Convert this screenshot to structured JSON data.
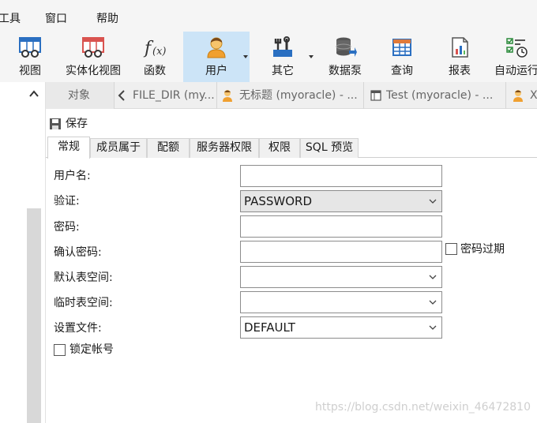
{
  "menu": {
    "tools": "工具",
    "window": "窗口",
    "help": "帮助"
  },
  "toolbar": {
    "view": "视图",
    "materialized_view": "实体化视图",
    "function": "函数",
    "user": "用户",
    "other": "其它",
    "data_pump": "数据泵",
    "query": "查询",
    "report": "报表",
    "auto_run": "自动运行"
  },
  "tabs": {
    "objects": "对象",
    "file_dir": "FILE_DIR (my...",
    "untitled": "无标题 (myoracle) - ...",
    "test": "Test (myoracle) - ...",
    "x": "X"
  },
  "save": "保存",
  "subtabs": {
    "general": "常规",
    "member_of": "成员属于",
    "quota": "配额",
    "server_privileges": "服务器权限",
    "privileges": "权限",
    "sql_preview": "SQL 预览"
  },
  "form": {
    "username_label": "用户名:",
    "username_value": "",
    "auth_label": "验证:",
    "auth_value": "PASSWORD",
    "password_label": "密码:",
    "password_value": "",
    "confirm_label": "确认密码:",
    "confirm_value": "",
    "password_expire_label": "密码过期",
    "default_tablespace_label": "默认表空间:",
    "default_tablespace_value": "",
    "temp_tablespace_label": "临时表空间:",
    "temp_tablespace_value": "",
    "profile_label": "设置文件:",
    "profile_value": "DEFAULT",
    "lock_account_label": "锁定帐号"
  },
  "watermark": "https://blog.csdn.net/weixin_46472810",
  "colors": {
    "active_tool_bg": "#cce4f7",
    "toolbar_bg": "#f5f5f5",
    "scrollbar": "#d8d8d8"
  }
}
